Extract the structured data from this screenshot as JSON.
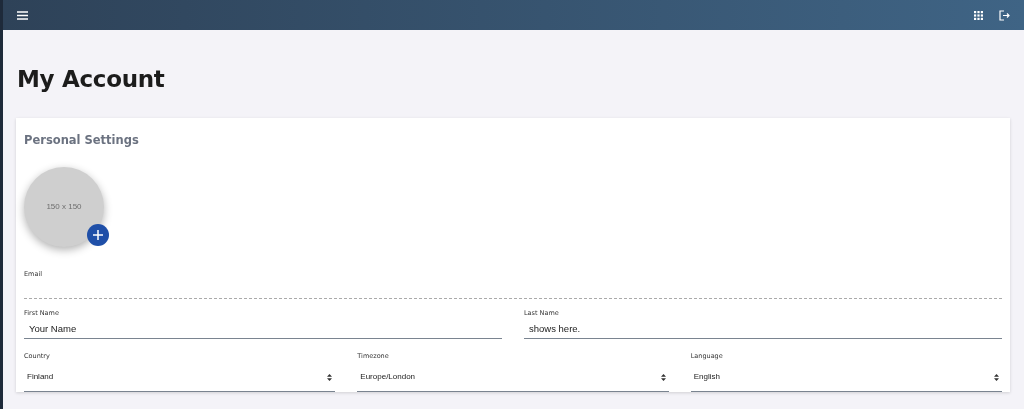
{
  "page_title": "My Account",
  "card": {
    "title": "Personal Settings",
    "avatar": {
      "placeholder_text": "150 x 150"
    }
  },
  "email": {
    "label": "Email",
    "disabled": true
  },
  "rows": [
    [
      {
        "kind": "text",
        "label": "First Name",
        "value": "Your Name"
      },
      {
        "kind": "text",
        "label": "Last Name",
        "value": "shows here."
      }
    ],
    [
      {
        "kind": "select",
        "label": "Country",
        "value": "Finland"
      },
      {
        "kind": "select",
        "label": "Timezone",
        "value": "Europe/London"
      },
      {
        "kind": "select",
        "label": "Language",
        "value": "English"
      }
    ]
  ]
}
